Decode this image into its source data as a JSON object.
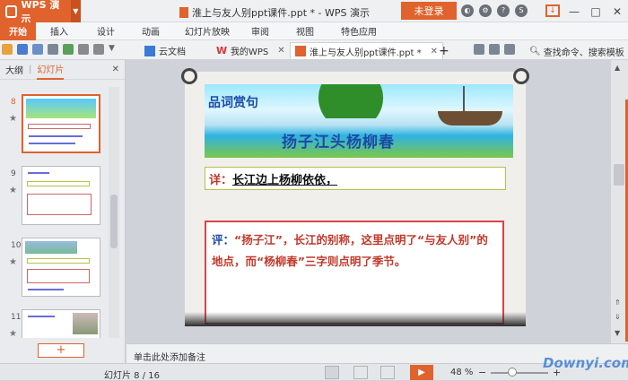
{
  "app": {
    "name": "WPS 演示"
  },
  "window": {
    "title": "淮上与友人别ppt课件.ppt * - WPS 演示",
    "login_label": "未登录"
  },
  "menu": {
    "items": [
      "开始",
      "插入",
      "设计",
      "动画",
      "幻灯片放映",
      "审阅",
      "视图",
      "特色应用"
    ]
  },
  "tabs": [
    {
      "label": "云文档"
    },
    {
      "label": "我的WPS"
    },
    {
      "label": "淮上与友人别ppt课件.ppt *"
    }
  ],
  "search": {
    "label": "查找命令、搜索模板"
  },
  "panel": {
    "tab_outline": "大纲",
    "tab_slides": "幻灯片"
  },
  "thumbnails": [
    {
      "num": "8",
      "star": "★",
      "selected": true
    },
    {
      "num": "9",
      "star": "★",
      "selected": false
    },
    {
      "num": "10",
      "star": "★",
      "selected": false
    },
    {
      "num": "11",
      "star": "★",
      "selected": false
    }
  ],
  "add_slide_label": "+",
  "slide": {
    "heading": "品词赏句",
    "banner_title": "扬子江头杨柳春",
    "xiang_key": "详：",
    "xiang_text": "长江边上杨柳依依，",
    "ping_key": "评：",
    "ping_text": "“扬子江”，长江的别称，这里点明了“与友人别”的地点，而“杨柳春”三字则点明了季节。"
  },
  "notes_placeholder": "单击此处添加备注",
  "status": {
    "slide_counter": "幻灯片 8 / 16",
    "zoom": "48 %",
    "zoom_minus": "−",
    "zoom_plus": "+"
  },
  "watermark": "Downyi.com",
  "colors": {
    "accent": "#e0622c",
    "title_blue": "#1a4aa8",
    "text_red": "#c0392b"
  }
}
